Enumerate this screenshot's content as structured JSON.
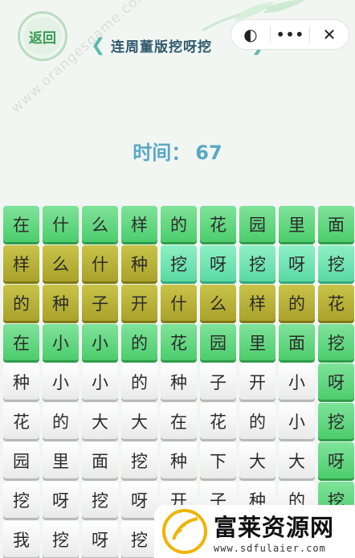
{
  "header": {
    "back_label": "返回",
    "title": "连周董版挖呀挖",
    "capsule_icons": [
      "game-center-icon",
      "more-icon",
      "close-icon"
    ],
    "capsule_glyphs": [
      "◐",
      "•••",
      "✕"
    ]
  },
  "watermark": "www.orangesgame.com",
  "timer": {
    "label": "时间：",
    "value": "67"
  },
  "board": {
    "rows": [
      {
        "chars": [
          "在",
          "什",
          "么",
          "样",
          "的",
          "花",
          "园",
          "里",
          "面"
        ],
        "colors": [
          "green",
          "green",
          "green",
          "green",
          "green",
          "green",
          "green",
          "green",
          "green"
        ]
      },
      {
        "chars": [
          "样",
          "么",
          "什",
          "种",
          "挖",
          "呀",
          "挖",
          "呀",
          "挖"
        ],
        "colors": [
          "olive",
          "olive",
          "olive",
          "olive",
          "mint",
          "mint",
          "mint",
          "mint",
          "mint"
        ]
      },
      {
        "chars": [
          "的",
          "种",
          "子",
          "开",
          "什",
          "么",
          "样",
          "的",
          "花"
        ],
        "colors": [
          "olive",
          "olive",
          "olive",
          "olive",
          "olive",
          "olive",
          "olive",
          "olive",
          "olive"
        ]
      },
      {
        "chars": [
          "在",
          "小",
          "小",
          "的",
          "花",
          "园",
          "里",
          "面",
          "挖"
        ],
        "colors": [
          "green",
          "green",
          "green",
          "green",
          "green",
          "green",
          "green",
          "green",
          "green"
        ]
      },
      {
        "chars": [
          "种",
          "小",
          "小",
          "的",
          "种",
          "子",
          "开",
          "小",
          "呀"
        ],
        "colors": [
          "white",
          "white",
          "white",
          "white",
          "white",
          "white",
          "white",
          "white",
          "green"
        ]
      },
      {
        "chars": [
          "花",
          "的",
          "大",
          "大",
          "在",
          "花",
          "的",
          "小",
          "挖"
        ],
        "colors": [
          "white",
          "white",
          "white",
          "white",
          "white",
          "white",
          "white",
          "white",
          "green"
        ]
      },
      {
        "chars": [
          "园",
          "里",
          "面",
          "挖",
          "种",
          "下",
          "大",
          "大",
          "呀"
        ],
        "colors": [
          "white",
          "white",
          "white",
          "white",
          "white",
          "white",
          "white",
          "white",
          "green"
        ]
      },
      {
        "chars": [
          "挖",
          "呀",
          "挖",
          "呀",
          "开",
          "子",
          "种",
          "的",
          "挖"
        ],
        "colors": [
          "white",
          "white",
          "white",
          "white",
          "white",
          "white",
          "white",
          "white",
          "green"
        ]
      },
      {
        "chars": [
          "我",
          "挖",
          "呀",
          "挖",
          "",
          "",
          "",
          "",
          ""
        ],
        "colors": [
          "white",
          "white",
          "white",
          "white",
          "white",
          "white",
          "white",
          "white",
          "white"
        ]
      }
    ],
    "palette": {
      "white": "#f4f5f4",
      "green": "#57d176",
      "mint": "#63dca8",
      "olive": "#b2ab33"
    }
  },
  "stamp": {
    "name": "富莱资源网",
    "url": "www.sdfulaier.com"
  }
}
